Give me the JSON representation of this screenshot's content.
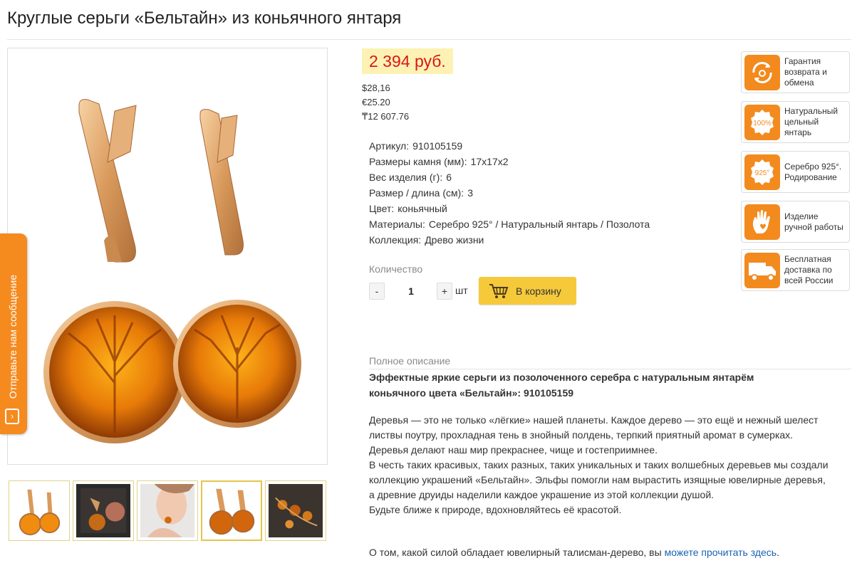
{
  "page_title": "Круглые серьги «Бельтайн» из коньячного янтаря",
  "price": {
    "main": "2 394 руб.",
    "usd": "$28,16",
    "eur": "€25.20",
    "kzt": "₸12 607.76"
  },
  "specs": [
    {
      "label": "Артикул:",
      "value": "910105159"
    },
    {
      "label": "Размеры камня (мм):",
      "value": "17x17x2"
    },
    {
      "label": "Вес изделия (г):",
      "value": "6"
    },
    {
      "label": "Размер / длина (см):",
      "value": "3"
    },
    {
      "label": "Цвет:",
      "value": "коньячный"
    },
    {
      "label": "Материалы:",
      "value": "Серебро 925° / Натуральный янтарь / Позолота"
    },
    {
      "label": "Коллекция:",
      "value": "Древо жизни"
    }
  ],
  "quantity": {
    "label": "Количество",
    "minus": "-",
    "value": "1",
    "plus": "+",
    "unit": "шт"
  },
  "cart_button": "В корзину",
  "badges": [
    {
      "icon": "return-exchange-icon",
      "text": "Гарантия возврата и обмена"
    },
    {
      "icon": "natural-100-icon",
      "icon_text": "100%",
      "text": "Натуральный цельный янтарь"
    },
    {
      "icon": "silver-925-icon",
      "icon_text": "925°",
      "text": "Серебро 925°. Родирование"
    },
    {
      "icon": "handmade-hand-icon",
      "text": "Изделие ручной работы"
    },
    {
      "icon": "delivery-truck-icon",
      "text": "Бесплатная доставка по всей России"
    }
  ],
  "feedback_tab": "Отправьте нам сообщение",
  "description": {
    "label": "Полное описание",
    "heading": "Эффектные яркие серьги из позолоченного серебра с натуральным янтарём коньячного цвета «Бельтайн»: 910105159",
    "paragraphs": [
      "Деревья — это не только «лёгкие» нашей планеты. Каждое дерево — это ещё и нежный шелест листвы поутру, прохладная тень в знойный полдень, терпкий приятный аромат в сумерках. Деревья делают наш мир прекраснее, чище и гостеприимнее.",
      "В честь таких красивых, таких разных, таких уникальных и таких волшебных деревьев мы создали коллекцию украшений «Бельтайн». Эльфы помогли нам вырастить изящные ювелирные деревья, а древние друиды наделили каждое украшение из этой коллекции душой.",
      "Будьте ближе к природе, вдохновляйтесь её красотой."
    ],
    "footer_text": "О том, какой силой обладает ювелирный талисман-дерево, вы ",
    "footer_link": "можете прочитать здесь",
    "footer_end": "."
  },
  "colors": {
    "price": "#d8181a",
    "price_bg": "#fdf2b4",
    "accent_orange": "#f28a1e",
    "cart_button": "#f6c93a",
    "link": "#1a62b3"
  }
}
